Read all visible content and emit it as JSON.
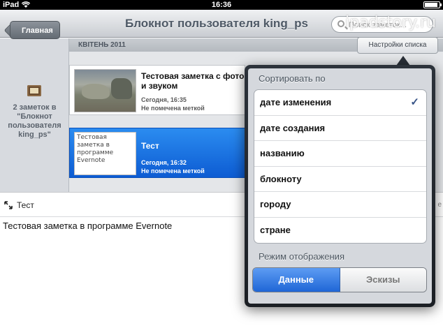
{
  "status_bar": {
    "carrier": "iPad",
    "time": "16:36"
  },
  "watermark": "ipadstory.ru",
  "nav": {
    "back_label": "Главная",
    "title": "Блокнот пользователя king_ps",
    "search_placeholder": "Поиск заметок..."
  },
  "left_pane": {
    "count_text": "2 заметок в \"Блокнот пользователя king_ps\""
  },
  "list": {
    "month_header": "КВІТЕНЬ 2011",
    "settings_tab": "Настройки списка",
    "notes": [
      {
        "title": "Тестовая заметка с фото и звуком",
        "date": "Сегодня, 16:35",
        "tag": "Не помечена меткой",
        "thumb_text": ""
      },
      {
        "title": "Тест",
        "date": "Сегодня, 16:32",
        "tag": "Не помечена меткой",
        "thumb_text": "Тестовая заметка в программе Evernote"
      }
    ]
  },
  "detail": {
    "title": "Тест",
    "body": "Тестовая заметка в программе Evernote",
    "right_fragment": "е"
  },
  "popover": {
    "sort_header": "Сортировать по",
    "sort_options": [
      "дате изменения",
      "дате создания",
      "названию",
      "блокноту",
      "городу",
      "стране"
    ],
    "selected_sort": "дате изменения",
    "display_header": "Режим отображения",
    "display_modes": [
      "Данные",
      "Эскизы"
    ],
    "active_display_mode": "Данные"
  },
  "colors": {
    "accent_blue": "#1f66d6",
    "selected_note": "#0d5cd3",
    "popover_border": "#2a3038"
  }
}
